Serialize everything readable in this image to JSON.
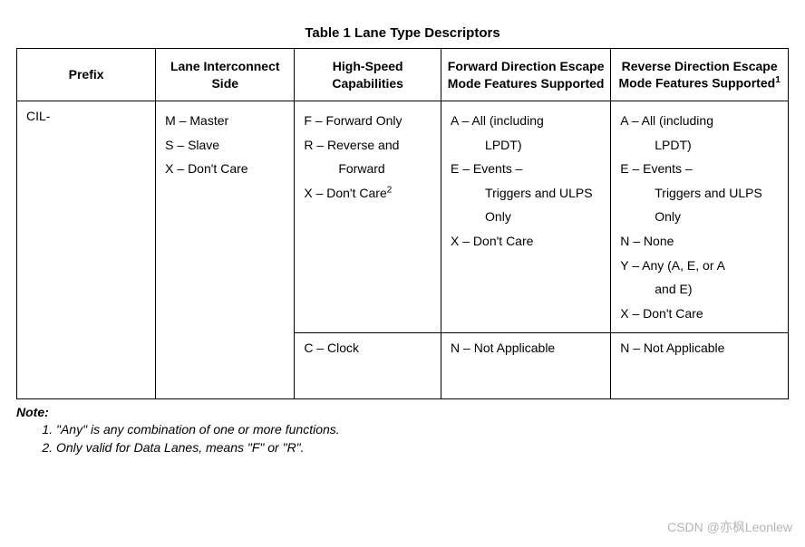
{
  "title": "Table 1 Lane Type Descriptors",
  "headers": {
    "prefix": "Prefix",
    "side": "Lane Interconnect Side",
    "hispeed": "High-Speed Capabilities",
    "fwd": "Forward Direction Escape Mode Features Supported",
    "rev": "Reverse Direction Escape Mode Features Supported",
    "rev_sup": "1"
  },
  "row1": {
    "prefix": "CIL-",
    "side": {
      "a": "M – Master",
      "b": "S – Slave",
      "c": "X – Don't Care"
    },
    "hispeed": {
      "a": "F – Forward Only",
      "b": "R – Reverse and",
      "b2": "Forward",
      "c": "X – Don't Care",
      "c_sup": "2"
    },
    "fwd": {
      "a": "A – All (including",
      "a2": "LPDT)",
      "b": "E – Events –",
      "b2": "Triggers and ULPS Only",
      "c": "X – Don't Care"
    },
    "rev": {
      "a": "A – All (including",
      "a2": "LPDT)",
      "b": "E – Events –",
      "b2": "Triggers and ULPS Only",
      "c": "N – None",
      "d": "Y – Any (A, E, or A",
      "d2": "and E)",
      "e": "X – Don't Care"
    }
  },
  "row2": {
    "hispeed": "C – Clock",
    "fwd": "N – Not Applicable",
    "rev": "N – Not Applicable"
  },
  "notes": {
    "head": "Note:",
    "n1": "\"Any\" is any combination of one or more functions.",
    "n2": "Only valid for Data Lanes, means \"F\" or \"R\"."
  },
  "watermark": "CSDN @亦枫Leonlew",
  "chart_data": {
    "type": "table",
    "title": "Table 1 Lane Type Descriptors",
    "columns": [
      "Prefix",
      "Lane Interconnect Side",
      "High-Speed Capabilities",
      "Forward Direction Escape Mode Features Supported",
      "Reverse Direction Escape Mode Features Supported"
    ],
    "rows": [
      {
        "Prefix": "CIL-",
        "Lane Interconnect Side": [
          "M – Master",
          "S – Slave",
          "X – Don't Care"
        ],
        "High-Speed Capabilities": [
          "F – Forward Only",
          "R – Reverse and Forward",
          "X – Don't Care"
        ],
        "Forward Direction Escape Mode Features Supported": [
          "A – All (including LPDT)",
          "E – Events – Triggers and ULPS Only",
          "X – Don't Care"
        ],
        "Reverse Direction Escape Mode Features Supported": [
          "A – All (including LPDT)",
          "E – Events – Triggers and ULPS Only",
          "N – None",
          "Y – Any (A, E, or A and E)",
          "X – Don't Care"
        ]
      },
      {
        "Prefix": "",
        "Lane Interconnect Side": "",
        "High-Speed Capabilities": "C – Clock",
        "Forward Direction Escape Mode Features Supported": "N – Not Applicable",
        "Reverse Direction Escape Mode Features Supported": "N – Not Applicable"
      }
    ],
    "footnotes": {
      "1": "\"Any\" is any combination of one or more functions.",
      "2": "Only valid for Data Lanes, means \"F\" or \"R\"."
    }
  }
}
